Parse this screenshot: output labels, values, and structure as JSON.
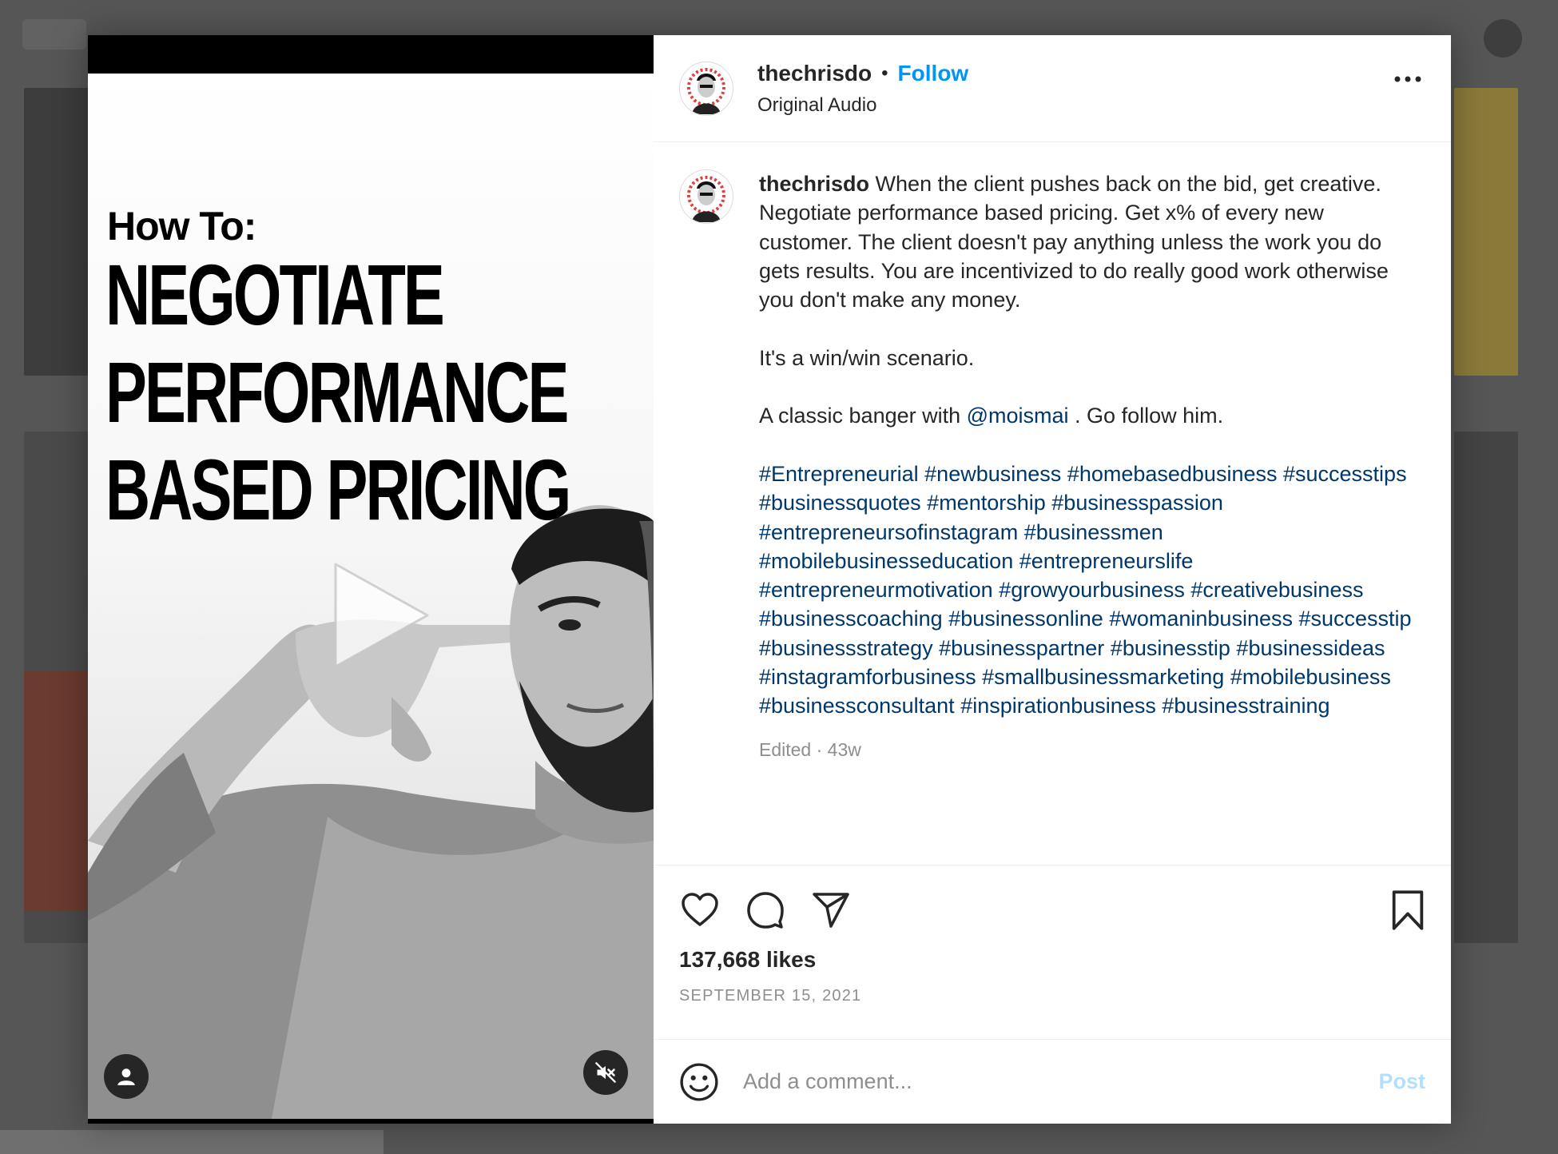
{
  "media": {
    "howto": "How To:",
    "headline": [
      "Negotiate",
      "Performance",
      "Based Pricing"
    ],
    "icons": {
      "play": "play-icon",
      "user_tag": "user-icon",
      "mute": "speaker-muted-icon"
    }
  },
  "header": {
    "username": "thechrisdo",
    "separator": "•",
    "follow_label": "Follow",
    "audio": "Original Audio",
    "more_icon": "more-horizontal-icon"
  },
  "caption": {
    "username": "thechrisdo",
    "text": "When the client pushes back on the bid, get creative. Negotiate performance based pricing. Get x% of every new customer. The client doesn't pay anything unless the work you do gets results. You are incentivized to do really good work otherwise you don't make any money.",
    "line2": "It's a win/win scenario.",
    "line3_prefix": "A classic banger with ",
    "mention": "@moismai",
    "line3_suffix": " . Go follow him.",
    "hashtags": [
      "#Entrepreneurial",
      "#newbusiness",
      "#homebasedbusiness",
      "#successtips",
      "#businessquotes",
      "#mentorship",
      "#businesspassion",
      "#entrepreneursofinstagram",
      "#businessmen",
      "#mobilebusinesseducation",
      "#entrepreneurslife",
      "#entrepreneurmotivation",
      "#growyourbusiness",
      "#creativebusiness",
      "#businesscoaching",
      "#businessonline",
      "#womaninbusiness",
      "#successtip",
      "#businessstrategy",
      "#businesspartner",
      "#businesstip",
      "#businessideas",
      "#instagramforbusiness",
      "#smallbusinessmarketing",
      "#mobilebusiness",
      "#businessconsultant",
      "#inspirationbusiness",
      "#businesstraining"
    ],
    "timestamp": "Edited · 43w"
  },
  "actions": {
    "icons": [
      "heart-icon",
      "comment-icon",
      "share-icon",
      "bookmark-icon"
    ],
    "likes": "137,668 likes",
    "date": "SEPTEMBER 15, 2021"
  },
  "comment": {
    "placeholder": "Add a comment...",
    "post_label": "Post",
    "emoji_icon": "smiley-icon"
  },
  "colors": {
    "link_blue": "#0095f6",
    "hashtag_blue": "#00376b",
    "text": "#262626",
    "muted": "#8e8e8e",
    "post_disabled": "#b2dffc"
  }
}
